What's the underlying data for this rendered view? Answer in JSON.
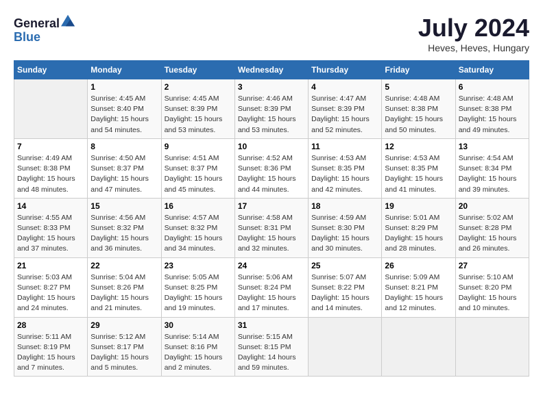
{
  "header": {
    "logo_line1": "General",
    "logo_line2": "Blue",
    "month_title": "July 2024",
    "location": "Heves, Heves, Hungary"
  },
  "weekdays": [
    "Sunday",
    "Monday",
    "Tuesday",
    "Wednesday",
    "Thursday",
    "Friday",
    "Saturday"
  ],
  "weeks": [
    [
      {
        "day": "",
        "sunrise": "",
        "sunset": "",
        "daylight": ""
      },
      {
        "day": "1",
        "sunrise": "Sunrise: 4:45 AM",
        "sunset": "Sunset: 8:40 PM",
        "daylight": "Daylight: 15 hours and 54 minutes."
      },
      {
        "day": "2",
        "sunrise": "Sunrise: 4:45 AM",
        "sunset": "Sunset: 8:39 PM",
        "daylight": "Daylight: 15 hours and 53 minutes."
      },
      {
        "day": "3",
        "sunrise": "Sunrise: 4:46 AM",
        "sunset": "Sunset: 8:39 PM",
        "daylight": "Daylight: 15 hours and 53 minutes."
      },
      {
        "day": "4",
        "sunrise": "Sunrise: 4:47 AM",
        "sunset": "Sunset: 8:39 PM",
        "daylight": "Daylight: 15 hours and 52 minutes."
      },
      {
        "day": "5",
        "sunrise": "Sunrise: 4:48 AM",
        "sunset": "Sunset: 8:38 PM",
        "daylight": "Daylight: 15 hours and 50 minutes."
      },
      {
        "day": "6",
        "sunrise": "Sunrise: 4:48 AM",
        "sunset": "Sunset: 8:38 PM",
        "daylight": "Daylight: 15 hours and 49 minutes."
      }
    ],
    [
      {
        "day": "7",
        "sunrise": "Sunrise: 4:49 AM",
        "sunset": "Sunset: 8:38 PM",
        "daylight": "Daylight: 15 hours and 48 minutes."
      },
      {
        "day": "8",
        "sunrise": "Sunrise: 4:50 AM",
        "sunset": "Sunset: 8:37 PM",
        "daylight": "Daylight: 15 hours and 47 minutes."
      },
      {
        "day": "9",
        "sunrise": "Sunrise: 4:51 AM",
        "sunset": "Sunset: 8:37 PM",
        "daylight": "Daylight: 15 hours and 45 minutes."
      },
      {
        "day": "10",
        "sunrise": "Sunrise: 4:52 AM",
        "sunset": "Sunset: 8:36 PM",
        "daylight": "Daylight: 15 hours and 44 minutes."
      },
      {
        "day": "11",
        "sunrise": "Sunrise: 4:53 AM",
        "sunset": "Sunset: 8:35 PM",
        "daylight": "Daylight: 15 hours and 42 minutes."
      },
      {
        "day": "12",
        "sunrise": "Sunrise: 4:53 AM",
        "sunset": "Sunset: 8:35 PM",
        "daylight": "Daylight: 15 hours and 41 minutes."
      },
      {
        "day": "13",
        "sunrise": "Sunrise: 4:54 AM",
        "sunset": "Sunset: 8:34 PM",
        "daylight": "Daylight: 15 hours and 39 minutes."
      }
    ],
    [
      {
        "day": "14",
        "sunrise": "Sunrise: 4:55 AM",
        "sunset": "Sunset: 8:33 PM",
        "daylight": "Daylight: 15 hours and 37 minutes."
      },
      {
        "day": "15",
        "sunrise": "Sunrise: 4:56 AM",
        "sunset": "Sunset: 8:32 PM",
        "daylight": "Daylight: 15 hours and 36 minutes."
      },
      {
        "day": "16",
        "sunrise": "Sunrise: 4:57 AM",
        "sunset": "Sunset: 8:32 PM",
        "daylight": "Daylight: 15 hours and 34 minutes."
      },
      {
        "day": "17",
        "sunrise": "Sunrise: 4:58 AM",
        "sunset": "Sunset: 8:31 PM",
        "daylight": "Daylight: 15 hours and 32 minutes."
      },
      {
        "day": "18",
        "sunrise": "Sunrise: 4:59 AM",
        "sunset": "Sunset: 8:30 PM",
        "daylight": "Daylight: 15 hours and 30 minutes."
      },
      {
        "day": "19",
        "sunrise": "Sunrise: 5:01 AM",
        "sunset": "Sunset: 8:29 PM",
        "daylight": "Daylight: 15 hours and 28 minutes."
      },
      {
        "day": "20",
        "sunrise": "Sunrise: 5:02 AM",
        "sunset": "Sunset: 8:28 PM",
        "daylight": "Daylight: 15 hours and 26 minutes."
      }
    ],
    [
      {
        "day": "21",
        "sunrise": "Sunrise: 5:03 AM",
        "sunset": "Sunset: 8:27 PM",
        "daylight": "Daylight: 15 hours and 24 minutes."
      },
      {
        "day": "22",
        "sunrise": "Sunrise: 5:04 AM",
        "sunset": "Sunset: 8:26 PM",
        "daylight": "Daylight: 15 hours and 21 minutes."
      },
      {
        "day": "23",
        "sunrise": "Sunrise: 5:05 AM",
        "sunset": "Sunset: 8:25 PM",
        "daylight": "Daylight: 15 hours and 19 minutes."
      },
      {
        "day": "24",
        "sunrise": "Sunrise: 5:06 AM",
        "sunset": "Sunset: 8:24 PM",
        "daylight": "Daylight: 15 hours and 17 minutes."
      },
      {
        "day": "25",
        "sunrise": "Sunrise: 5:07 AM",
        "sunset": "Sunset: 8:22 PM",
        "daylight": "Daylight: 15 hours and 14 minutes."
      },
      {
        "day": "26",
        "sunrise": "Sunrise: 5:09 AM",
        "sunset": "Sunset: 8:21 PM",
        "daylight": "Daylight: 15 hours and 12 minutes."
      },
      {
        "day": "27",
        "sunrise": "Sunrise: 5:10 AM",
        "sunset": "Sunset: 8:20 PM",
        "daylight": "Daylight: 15 hours and 10 minutes."
      }
    ],
    [
      {
        "day": "28",
        "sunrise": "Sunrise: 5:11 AM",
        "sunset": "Sunset: 8:19 PM",
        "daylight": "Daylight: 15 hours and 7 minutes."
      },
      {
        "day": "29",
        "sunrise": "Sunrise: 5:12 AM",
        "sunset": "Sunset: 8:17 PM",
        "daylight": "Daylight: 15 hours and 5 minutes."
      },
      {
        "day": "30",
        "sunrise": "Sunrise: 5:14 AM",
        "sunset": "Sunset: 8:16 PM",
        "daylight": "Daylight: 15 hours and 2 minutes."
      },
      {
        "day": "31",
        "sunrise": "Sunrise: 5:15 AM",
        "sunset": "Sunset: 8:15 PM",
        "daylight": "Daylight: 14 hours and 59 minutes."
      },
      {
        "day": "",
        "sunrise": "",
        "sunset": "",
        "daylight": ""
      },
      {
        "day": "",
        "sunrise": "",
        "sunset": "",
        "daylight": ""
      },
      {
        "day": "",
        "sunrise": "",
        "sunset": "",
        "daylight": ""
      }
    ]
  ]
}
